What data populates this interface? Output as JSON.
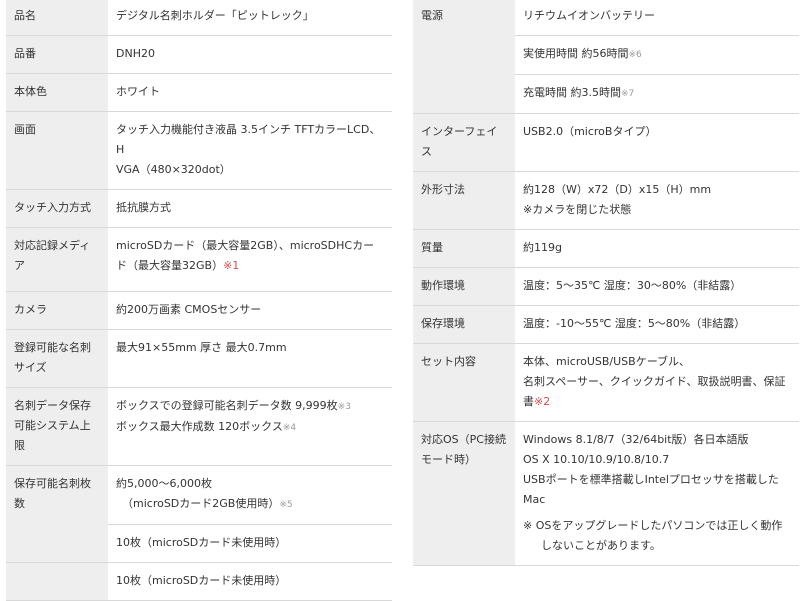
{
  "left": {
    "rows": [
      {
        "label": "品名",
        "lines": [
          "デジタル名刺ホルダー「ピットレック」"
        ]
      },
      {
        "label": "品番",
        "lines": [
          "DNH20"
        ]
      },
      {
        "label": "本体色",
        "lines": [
          "ホワイト"
        ]
      },
      {
        "label": "画面",
        "lines": [
          "タッチ入力機能付き液晶 3.5インチ TFTカラーLCD、H",
          "VGA（480×320dot）"
        ]
      },
      {
        "label": "タッチ入力方式",
        "lines": [
          "抵抗膜方式"
        ]
      },
      {
        "label": "対応記録メディア",
        "lines": [
          "microSDカード（最大容量2GB）、microSDHCカー",
          "ド（最大容量32GB）"
        ],
        "mark": "※1"
      },
      {
        "label": "カメラ",
        "lines": [
          "約200万画素 CMOSセンサー"
        ]
      },
      {
        "label": "登録可能な名刺サイズ",
        "lines": [
          "最大91×55mm 厚さ 最大0.7mm"
        ]
      },
      {
        "label": "名刺データ保存可能システム上限",
        "line1": "ボックスでの登録可能名刺データ数 9,999枚",
        "note1": "※3",
        "line2": "ボックス最大作成数 120ボックス",
        "note2": "※4"
      },
      {
        "label": "保存可能名刺枚数",
        "line1": "約5,000～6,000枚",
        "line2": "（microSDカード2GB使用時）",
        "note2": "※5",
        "sub": "10枚（microSDカード未使用時）"
      },
      {
        "label": "",
        "lines": [
          "10枚（microSDカード未使用時）"
        ]
      }
    ]
  },
  "right": {
    "rows": [
      {
        "label": "電源",
        "lines": [
          "リチウムイオンバッテリー"
        ]
      },
      {
        "label": "",
        "line": "実使用時間 約56時間",
        "note": "※6"
      },
      {
        "label": "",
        "line": "充電時間 約3.5時間",
        "note": "※7"
      },
      {
        "label": "インターフェイス",
        "lines": [
          "USB2.0（microBタイプ）"
        ]
      },
      {
        "label": "外形寸法",
        "lines": [
          "約128（W）x72（D）x15（H）mm",
          "※カメラを閉じた状態"
        ]
      },
      {
        "label": "質量",
        "lines": [
          "約119g"
        ]
      },
      {
        "label": "動作環境",
        "lines": [
          "温度：5～35℃ 湿度：30～80%（非結露）"
        ]
      },
      {
        "label": "保存環境",
        "lines": [
          "温度：-10～55℃ 湿度：5～80%（非結露）"
        ]
      },
      {
        "label": "セット内容",
        "lines": [
          "本体、microUSB/USBケーブル、",
          "名刺スペーサー、クイックガイド、取扱説明書、保証",
          "書"
        ],
        "mark": "※2"
      },
      {
        "label": "対応OS（PC接続モード時）",
        "lines": [
          "Windows 8.1/8/7（32/64bit版）各日本語版",
          "OS X 10.10/10.9/10.8/10.7",
          "USBポートを標準搭載しIntelプロセッサを搭載したMac"
        ],
        "os_note": "※ OSをアップグレードしたパソコンでは正しく動作しないことがあります。"
      }
    ]
  }
}
